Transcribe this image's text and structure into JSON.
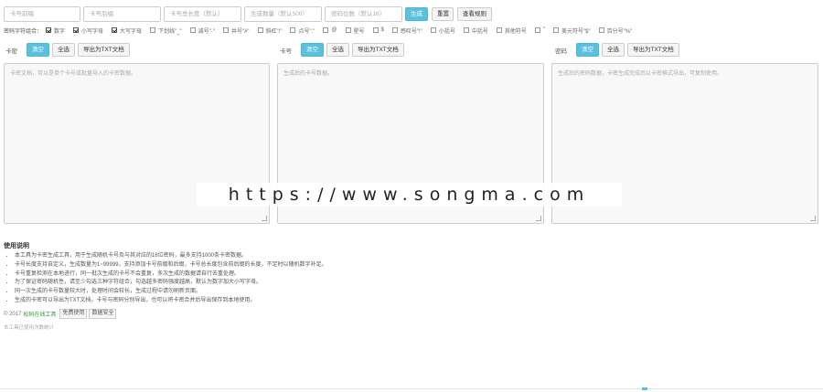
{
  "top_inputs": [
    {
      "placeholder": "卡号前缀"
    },
    {
      "placeholder": "卡号后缀"
    },
    {
      "placeholder": "卡号总长度（默认）"
    },
    {
      "placeholder": "生成数量（默认500）"
    },
    {
      "placeholder": "密码位数（默认16）"
    }
  ],
  "toolbar": {
    "generate_label": "生成",
    "reset_label": "重置",
    "view_rules_label": "查看规则"
  },
  "charset": {
    "label": "密码字符组合：",
    "options": [
      {
        "label": "数字",
        "checked": true
      },
      {
        "label": "小写字母",
        "checked": true
      },
      {
        "label": "大写字母",
        "checked": true
      },
      {
        "label": "下划线\"_\"",
        "checked": false
      },
      {
        "label": "减号\"-\"",
        "checked": false
      },
      {
        "label": "井号\"#\"",
        "checked": false
      },
      {
        "label": "斜杠\"/\"",
        "checked": false
      },
      {
        "label": "点号\".\"",
        "checked": false
      },
      {
        "label": "@",
        "checked": false
      },
      {
        "label": "星号",
        "checked": false
      },
      {
        "label": "$",
        "checked": false
      },
      {
        "label": "感叹号\"!\"",
        "checked": false
      },
      {
        "label": "小括号",
        "checked": false
      },
      {
        "label": "中括号",
        "checked": false
      },
      {
        "label": "其他符号",
        "checked": false
      },
      {
        "label": "\"",
        "checked": false
      },
      {
        "label": "美元符号\"$\"",
        "checked": false
      },
      {
        "label": "百分号\"%\"",
        "checked": false
      }
    ]
  },
  "panels": [
    {
      "title": "卡密",
      "clear": "清空",
      "select_all": "全选",
      "export": "导出为TXT文档",
      "placeholder": "卡密文档，可以是单个卡号或批量导入的卡密数据。"
    },
    {
      "title": "卡号",
      "clear": "清空",
      "select_all": "全选",
      "export": "导出为TXT文档",
      "placeholder": "生成后的卡号数据。"
    },
    {
      "title": "密码",
      "clear": "清空",
      "select_all": "全选",
      "export": "导出为TXT文档",
      "placeholder": "生成后的密码数据，卡密生成完成后以卡密格式导出，可复制使用。"
    }
  ],
  "watermark": "https://www.songma.com",
  "usage": {
    "title": "使用说明",
    "items": [
      "本工具为卡密生成工具，用于生成随机卡号及与其对应的16位密码，最多支持1000条卡密数据。",
      "卡号长度支持自定义，生成数量为1~99999，支持添加卡号前缀和后缀，卡号总长度包含前后缀的长度，不足时以随机数字补足。",
      "卡号重复检测在本地进行，同一批次生成的卡号不会重复，多次生成的数据请自行去重处理。",
      "为了保证密码随机性，请至少勾选三种字符组合，勾选越多密码强度越高，默认为数字加大小写字母。",
      "同一次生成的卡号数量较大时，处理时间会较长，生成过程中请勿刷新页面。",
      "生成的卡密可以导出为TXT文档，卡号与密码分别导出，也可以将卡密合并后导出保存到本地使用。"
    ]
  },
  "footer": {
    "copyright": "© 2017",
    "site_link": "松码在线工具",
    "tags": [
      "免费使用",
      "数据安全"
    ]
  },
  "stats_text": "本工具已使用次数统计"
}
